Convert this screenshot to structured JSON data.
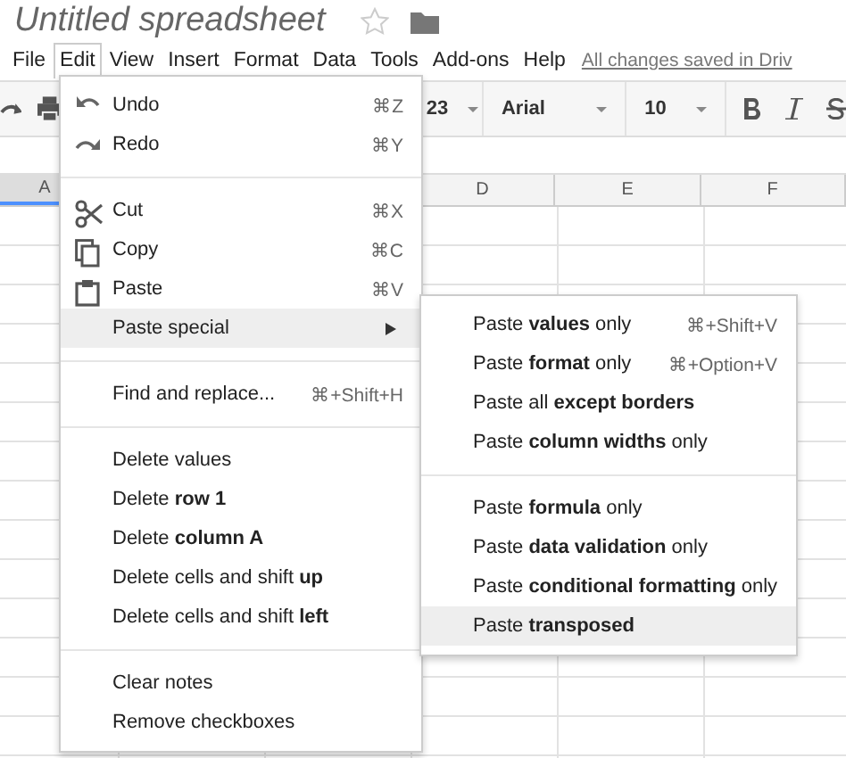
{
  "document": {
    "title": "Untitled spreadsheet",
    "starred": false
  },
  "menubar": {
    "items": [
      {
        "label": "File",
        "selected": false
      },
      {
        "label": "Edit",
        "selected": true
      },
      {
        "label": "View",
        "selected": false
      },
      {
        "label": "Insert",
        "selected": false
      },
      {
        "label": "Format",
        "selected": false
      },
      {
        "label": "Data",
        "selected": false
      },
      {
        "label": "Tools",
        "selected": false
      },
      {
        "label": "Add-ons",
        "selected": false
      },
      {
        "label": "Help",
        "selected": false
      }
    ],
    "save_status": "All changes saved in Driv"
  },
  "toolbar": {
    "number_format": "23",
    "font": "Arial",
    "font_size": "10"
  },
  "sheet": {
    "columns": [
      {
        "label": "A",
        "selected": true
      },
      {
        "label": "D",
        "selected": false
      },
      {
        "label": "E",
        "selected": false
      },
      {
        "label": "F",
        "selected": false
      }
    ]
  },
  "edit_menu": {
    "items": [
      {
        "kind": "item",
        "label": "Undo",
        "shortcut": "⌘Z",
        "highlighted": false,
        "submenu": false
      },
      {
        "kind": "item",
        "label": "Redo",
        "shortcut": "⌘Y",
        "highlighted": false,
        "submenu": false
      },
      {
        "kind": "separator"
      },
      {
        "kind": "item",
        "label": "Cut",
        "shortcut": "⌘X",
        "highlighted": false,
        "submenu": false
      },
      {
        "kind": "item",
        "label": "Copy",
        "shortcut": "⌘C",
        "highlighted": false,
        "submenu": false
      },
      {
        "kind": "item",
        "label": "Paste",
        "shortcut": "⌘V",
        "highlighted": false,
        "submenu": false
      },
      {
        "kind": "item",
        "label": "Paste special",
        "highlighted": true,
        "submenu": true
      },
      {
        "kind": "separator"
      },
      {
        "kind": "item",
        "label": "Find and replace...",
        "shortcut": "⌘+Shift+H",
        "highlighted": false,
        "submenu": false
      },
      {
        "kind": "separator"
      },
      {
        "kind": "item",
        "label": "Delete values",
        "highlighted": false,
        "submenu": false
      },
      {
        "kind": "item",
        "label": "Delete **row 1**",
        "highlighted": false,
        "submenu": false
      },
      {
        "kind": "item",
        "label": "Delete **column A**",
        "highlighted": false,
        "submenu": false
      },
      {
        "kind": "item",
        "label": "Delete cells and shift **up**",
        "highlighted": false,
        "submenu": false
      },
      {
        "kind": "item",
        "label": "Delete cells and shift **left**",
        "highlighted": false,
        "submenu": false
      },
      {
        "kind": "separator"
      },
      {
        "kind": "item",
        "label": "Clear notes",
        "highlighted": false,
        "submenu": false
      },
      {
        "kind": "item",
        "label": "Remove checkboxes",
        "highlighted": false,
        "submenu": false
      }
    ]
  },
  "paste_special_menu": {
    "items": [
      {
        "kind": "item",
        "label": "Paste **values** only",
        "shortcut": "⌘+Shift+V",
        "highlighted": false,
        "submenu": false
      },
      {
        "kind": "item",
        "label": "Paste **format** only",
        "shortcut": "⌘+Option+V",
        "highlighted": false,
        "submenu": false
      },
      {
        "kind": "item",
        "label": "Paste all **except borders**",
        "highlighted": false,
        "submenu": false
      },
      {
        "kind": "item",
        "label": "Paste **column widths** only",
        "highlighted": false,
        "submenu": false
      },
      {
        "kind": "separator"
      },
      {
        "kind": "item",
        "label": "Paste **formula** only",
        "highlighted": false,
        "submenu": false
      },
      {
        "kind": "item",
        "label": "Paste **data validation** only",
        "highlighted": false,
        "submenu": false
      },
      {
        "kind": "item",
        "label": "Paste **conditional formatting** only",
        "highlighted": false,
        "submenu": false
      },
      {
        "kind": "item",
        "label": "Paste **transposed**",
        "highlighted": true,
        "submenu": false
      }
    ]
  }
}
